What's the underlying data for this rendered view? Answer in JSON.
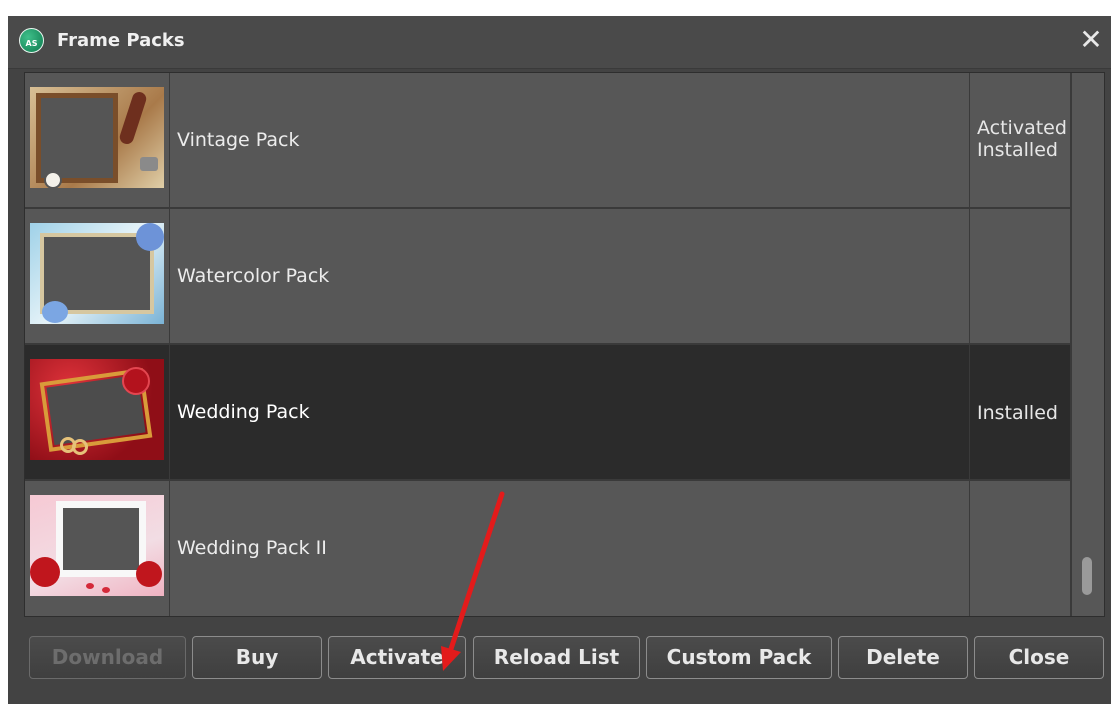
{
  "window": {
    "title": "Frame Packs",
    "icon": "app-icon",
    "icon_text": "AS",
    "close_icon": "close-icon"
  },
  "packs": [
    {
      "name": "Vintage Pack",
      "status_line1": "Activated",
      "status_line2": "Installed"
    },
    {
      "name": "Watercolor Pack",
      "status_line1": "",
      "status_line2": ""
    },
    {
      "name": "Wedding Pack",
      "status_line1": "Installed",
      "status_line2": "",
      "selected": true
    },
    {
      "name": "Wedding Pack II",
      "status_line1": "",
      "status_line2": ""
    }
  ],
  "buttons": {
    "download": "Download",
    "buy": "Buy",
    "activate": "Activate",
    "reload": "Reload List",
    "custom": "Custom Pack",
    "delete": "Delete",
    "close": "Close"
  },
  "colors": {
    "selected_row": "#2b2b2b",
    "annotation_arrow": "#e31b1b"
  }
}
